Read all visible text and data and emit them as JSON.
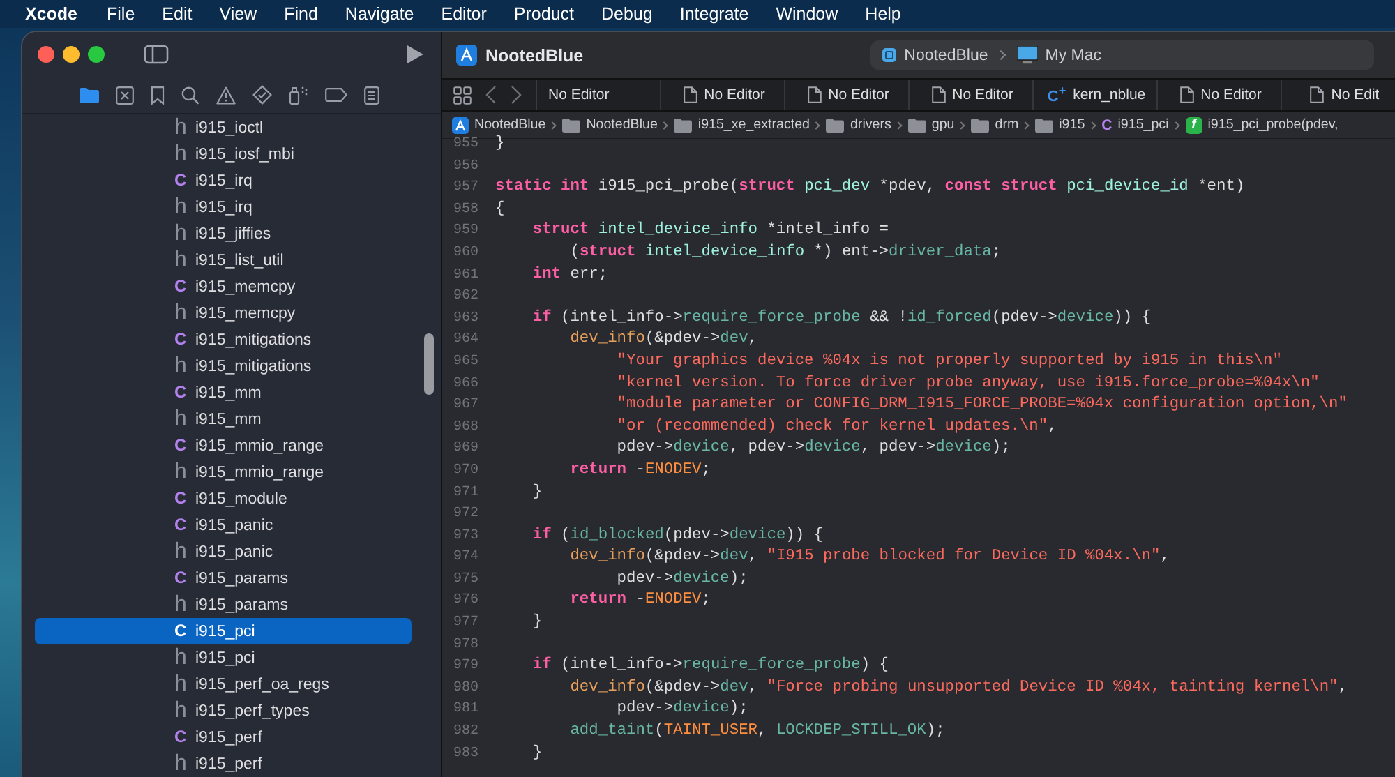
{
  "menu_bar": {
    "app": "Xcode",
    "items": [
      "File",
      "Edit",
      "View",
      "Find",
      "Navigate",
      "Editor",
      "Product",
      "Debug",
      "Integrate",
      "Window",
      "Help"
    ]
  },
  "navigator": {
    "files": [
      {
        "icon": "h",
        "kind": "h",
        "name": "i915_ioctl",
        "selected": false
      },
      {
        "icon": "h",
        "kind": "h",
        "name": "i915_iosf_mbi",
        "selected": false
      },
      {
        "icon": "C",
        "kind": "c",
        "name": "i915_irq",
        "selected": false
      },
      {
        "icon": "h",
        "kind": "h",
        "name": "i915_irq",
        "selected": false
      },
      {
        "icon": "h",
        "kind": "h",
        "name": "i915_jiffies",
        "selected": false
      },
      {
        "icon": "h",
        "kind": "h",
        "name": "i915_list_util",
        "selected": false
      },
      {
        "icon": "C",
        "kind": "c",
        "name": "i915_memcpy",
        "selected": false
      },
      {
        "icon": "h",
        "kind": "h",
        "name": "i915_memcpy",
        "selected": false
      },
      {
        "icon": "C",
        "kind": "c",
        "name": "i915_mitigations",
        "selected": false
      },
      {
        "icon": "h",
        "kind": "h",
        "name": "i915_mitigations",
        "selected": false
      },
      {
        "icon": "C",
        "kind": "c",
        "name": "i915_mm",
        "selected": false
      },
      {
        "icon": "h",
        "kind": "h",
        "name": "i915_mm",
        "selected": false
      },
      {
        "icon": "C",
        "kind": "c",
        "name": "i915_mmio_range",
        "selected": false
      },
      {
        "icon": "h",
        "kind": "h",
        "name": "i915_mmio_range",
        "selected": false
      },
      {
        "icon": "C",
        "kind": "c",
        "name": "i915_module",
        "selected": false
      },
      {
        "icon": "C",
        "kind": "c",
        "name": "i915_panic",
        "selected": false
      },
      {
        "icon": "h",
        "kind": "h",
        "name": "i915_panic",
        "selected": false
      },
      {
        "icon": "C",
        "kind": "c",
        "name": "i915_params",
        "selected": false
      },
      {
        "icon": "h",
        "kind": "h",
        "name": "i915_params",
        "selected": false
      },
      {
        "icon": "C",
        "kind": "c",
        "name": "i915_pci",
        "selected": true
      },
      {
        "icon": "h",
        "kind": "h",
        "name": "i915_pci",
        "selected": false
      },
      {
        "icon": "h",
        "kind": "h",
        "name": "i915_perf_oa_regs",
        "selected": false
      },
      {
        "icon": "h",
        "kind": "h",
        "name": "i915_perf_types",
        "selected": false
      },
      {
        "icon": "C",
        "kind": "c",
        "name": "i915_perf",
        "selected": false
      },
      {
        "icon": "h",
        "kind": "h",
        "name": "i915_perf",
        "selected": false
      }
    ]
  },
  "toolbar": {
    "project": "NootedBlue",
    "scheme": "NootedBlue",
    "destination": "My Mac"
  },
  "tabs": [
    {
      "kind": "plain",
      "label": "No Editor"
    },
    {
      "kind": "document",
      "label": "No Editor"
    },
    {
      "kind": "document",
      "label": "No Editor"
    },
    {
      "kind": "document",
      "label": "No Editor"
    },
    {
      "kind": "source",
      "icon": "C$^{+}$",
      "label": "kern_nblue"
    },
    {
      "kind": "document",
      "label": "No Editor"
    },
    {
      "kind": "document",
      "label": "No Edit"
    }
  ],
  "breadcrumb": [
    {
      "kind": "project",
      "label": "NootedBlue"
    },
    {
      "kind": "folder",
      "label": "NootedBlue"
    },
    {
      "kind": "folder",
      "label": "i915_xe_extracted"
    },
    {
      "kind": "folder",
      "label": "drivers"
    },
    {
      "kind": "folder",
      "label": "gpu"
    },
    {
      "kind": "folder",
      "label": "drm"
    },
    {
      "kind": "folder",
      "label": "i915"
    },
    {
      "kind": "c",
      "icon": "C",
      "label": "i915_pci"
    },
    {
      "kind": "function",
      "icon": "f",
      "label": "i915_pci_probe(pdev,"
    }
  ],
  "code": {
    "lines": [
      {
        "number": "955",
        "tokens": [
          {
            "kind": "plain",
            "text": "}"
          }
        ]
      },
      {
        "number": "956"
      },
      {
        "number": "957",
        "tokens": [
          {
            "kind": "kw",
            "text": "static int"
          },
          {
            "kind": "plain",
            "text": " i915_pci_probe("
          },
          {
            "kind": "kw",
            "text": "struct"
          },
          {
            "kind": "type",
            "text": " pci_dev"
          },
          {
            "kind": "plain",
            "text": " *pdev, "
          },
          {
            "kind": "kw",
            "text": "const struct"
          },
          {
            "kind": "type",
            "text": " pci_device_id"
          },
          {
            "kind": "plain",
            "text": " *ent)"
          }
        ]
      },
      {
        "number": "958",
        "tokens": [
          {
            "kind": "plain",
            "text": "{"
          }
        ]
      },
      {
        "number": "959",
        "tokens": [
          {
            "kind": "kw",
            "text": "    struct"
          },
          {
            "kind": "type",
            "text": " intel_device_info"
          },
          {
            "kind": "plain",
            "text": " *intel_info ="
          }
        ]
      },
      {
        "number": "960",
        "tokens": [
          {
            "kind": "plain",
            "text": "        ("
          },
          {
            "kind": "kw",
            "text": "struct"
          },
          {
            "kind": "type",
            "text": " intel_device_info"
          },
          {
            "kind": "plain",
            "text": " *) ent->"
          },
          {
            "kind": "ident",
            "text": "driver_data"
          },
          {
            "kind": "plain",
            "text": ";"
          }
        ]
      },
      {
        "number": "961",
        "tokens": [
          {
            "kind": "kw",
            "text": "    int"
          },
          {
            "kind": "plain",
            "text": " err;"
          }
        ]
      },
      {
        "number": "962"
      },
      {
        "number": "963",
        "tokens": [
          {
            "kind": "kw",
            "text": "    if"
          },
          {
            "kind": "plain",
            "text": " (intel_info->"
          },
          {
            "kind": "ident",
            "text": "require_force_probe"
          },
          {
            "kind": "plain",
            "text": " && !"
          },
          {
            "kind": "ident",
            "text": "id_forced"
          },
          {
            "kind": "plain",
            "text": "(pdev->"
          },
          {
            "kind": "ident",
            "text": "device"
          },
          {
            "kind": "plain",
            "text": ")) {"
          }
        ]
      },
      {
        "number": "964",
        "tokens": [
          {
            "kind": "fn",
            "text": "        dev_info"
          },
          {
            "kind": "plain",
            "text": "(&pdev->"
          },
          {
            "kind": "ident",
            "text": "dev"
          },
          {
            "kind": "plain",
            "text": ","
          }
        ]
      },
      {
        "number": "965",
        "tokens": [
          {
            "kind": "str",
            "text": "             \"Your graphics device %04x is not properly supported by i915 in this\\n\""
          }
        ]
      },
      {
        "number": "966",
        "tokens": [
          {
            "kind": "str",
            "text": "             \"kernel version. To force driver probe anyway, use i915.force_probe=%04x\\n\""
          }
        ]
      },
      {
        "number": "967",
        "tokens": [
          {
            "kind": "str",
            "text": "             \"module parameter or CONFIG_DRM_I915_FORCE_PROBE=%04x configuration option,\\n\""
          }
        ]
      },
      {
        "number": "968",
        "tokens": [
          {
            "kind": "str",
            "text": "             \"or (recommended) check for kernel updates.\\n\""
          },
          {
            "kind": "plain",
            "text": ","
          }
        ]
      },
      {
        "number": "969",
        "tokens": [
          {
            "kind": "plain",
            "text": "             pdev->"
          },
          {
            "kind": "ident",
            "text": "device"
          },
          {
            "kind": "plain",
            "text": ", pdev->"
          },
          {
            "kind": "ident",
            "text": "device"
          },
          {
            "kind": "plain",
            "text": ", pdev->"
          },
          {
            "kind": "ident",
            "text": "device"
          },
          {
            "kind": "plain",
            "text": ");"
          }
        ]
      },
      {
        "number": "970",
        "tokens": [
          {
            "kind": "kw",
            "text": "        return"
          },
          {
            "kind": "plain",
            "text": " -"
          },
          {
            "kind": "macro",
            "text": "ENODEV"
          },
          {
            "kind": "plain",
            "text": ";"
          }
        ]
      },
      {
        "number": "971",
        "tokens": [
          {
            "kind": "plain",
            "text": "    }"
          }
        ]
      },
      {
        "number": "972"
      },
      {
        "number": "973",
        "tokens": [
          {
            "kind": "kw",
            "text": "    if"
          },
          {
            "kind": "plain",
            "text": " ("
          },
          {
            "kind": "ident",
            "text": "id_blocked"
          },
          {
            "kind": "plain",
            "text": "(pdev->"
          },
          {
            "kind": "ident",
            "text": "device"
          },
          {
            "kind": "plain",
            "text": ")) {"
          }
        ]
      },
      {
        "number": "974",
        "tokens": [
          {
            "kind": "fn",
            "text": "        dev_info"
          },
          {
            "kind": "plain",
            "text": "(&pdev->"
          },
          {
            "kind": "ident",
            "text": "dev"
          },
          {
            "kind": "plain",
            "text": ", "
          },
          {
            "kind": "str",
            "text": "\"I915 probe blocked for Device ID %04x.\\n\""
          },
          {
            "kind": "plain",
            "text": ","
          }
        ]
      },
      {
        "number": "975",
        "tokens": [
          {
            "kind": "plain",
            "text": "             pdev->"
          },
          {
            "kind": "ident",
            "text": "device"
          },
          {
            "kind": "plain",
            "text": ");"
          }
        ]
      },
      {
        "number": "976",
        "tokens": [
          {
            "kind": "kw",
            "text": "        return"
          },
          {
            "kind": "plain",
            "text": " -"
          },
          {
            "kind": "macro",
            "text": "ENODEV"
          },
          {
            "kind": "plain",
            "text": ";"
          }
        ]
      },
      {
        "number": "977",
        "tokens": [
          {
            "kind": "plain",
            "text": "    }"
          }
        ]
      },
      {
        "number": "978"
      },
      {
        "number": "979",
        "tokens": [
          {
            "kind": "kw",
            "text": "    if"
          },
          {
            "kind": "plain",
            "text": " (intel_info->"
          },
          {
            "kind": "ident",
            "text": "require_force_probe"
          },
          {
            "kind": "plain",
            "text": ") {"
          }
        ]
      },
      {
        "number": "980",
        "tokens": [
          {
            "kind": "fn",
            "text": "        dev_info"
          },
          {
            "kind": "plain",
            "text": "(&pdev->"
          },
          {
            "kind": "ident",
            "text": "dev"
          },
          {
            "kind": "plain",
            "text": ", "
          },
          {
            "kind": "str",
            "text": "\"Force probing unsupported Device ID %04x, tainting kernel\\n\""
          },
          {
            "kind": "plain",
            "text": ","
          }
        ]
      },
      {
        "number": "981",
        "tokens": [
          {
            "kind": "plain",
            "text": "             pdev->"
          },
          {
            "kind": "ident",
            "text": "device"
          },
          {
            "kind": "plain",
            "text": ");"
          }
        ]
      },
      {
        "number": "982",
        "tokens": [
          {
            "kind": "ident",
            "text": "        add_taint"
          },
          {
            "kind": "plain",
            "text": "("
          },
          {
            "kind": "macro",
            "text": "TAINT_USER"
          },
          {
            "kind": "plain",
            "text": ", "
          },
          {
            "kind": "ident",
            "text": "LOCKDEP_STILL_OK"
          },
          {
            "kind": "plain",
            "text": ");"
          }
        ]
      },
      {
        "number": "983",
        "tokens": [
          {
            "kind": "plain",
            "text": "    }"
          }
        ]
      }
    ]
  }
}
